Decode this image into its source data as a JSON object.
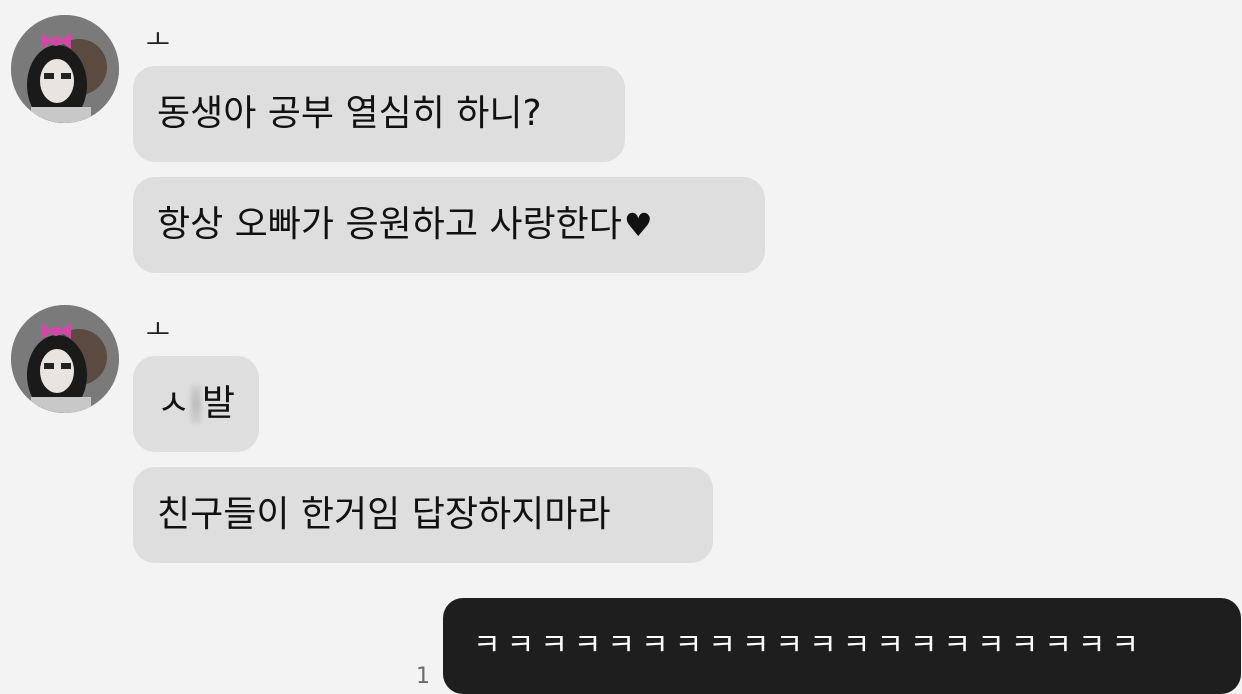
{
  "messages": [
    {
      "sender": "ㅗ",
      "text": "동생아 공부 열심히 하니?"
    },
    {
      "text": "항상 오빠가 응원하고 사랑한다",
      "suffix": "♥"
    },
    {
      "sender": "ㅗ",
      "text_pre": "ㅅ",
      "text_post": "발",
      "censored": true
    },
    {
      "text": "친구들이 한거임 답장하지마라"
    },
    {
      "text": "ㅋㅋㅋㅋㅋㅋㅋㅋㅋㅋㅋㅋㅋㅋㅋㅋㅋㅋㅋㅋ",
      "unread": "1",
      "mine": true
    }
  ],
  "colors": {
    "background": "#f3f3f3",
    "incoming_bubble": "#dedede",
    "outgoing_bubble": "#1e1e1e"
  },
  "icons": [
    "avatar-image",
    "heart-icon"
  ]
}
